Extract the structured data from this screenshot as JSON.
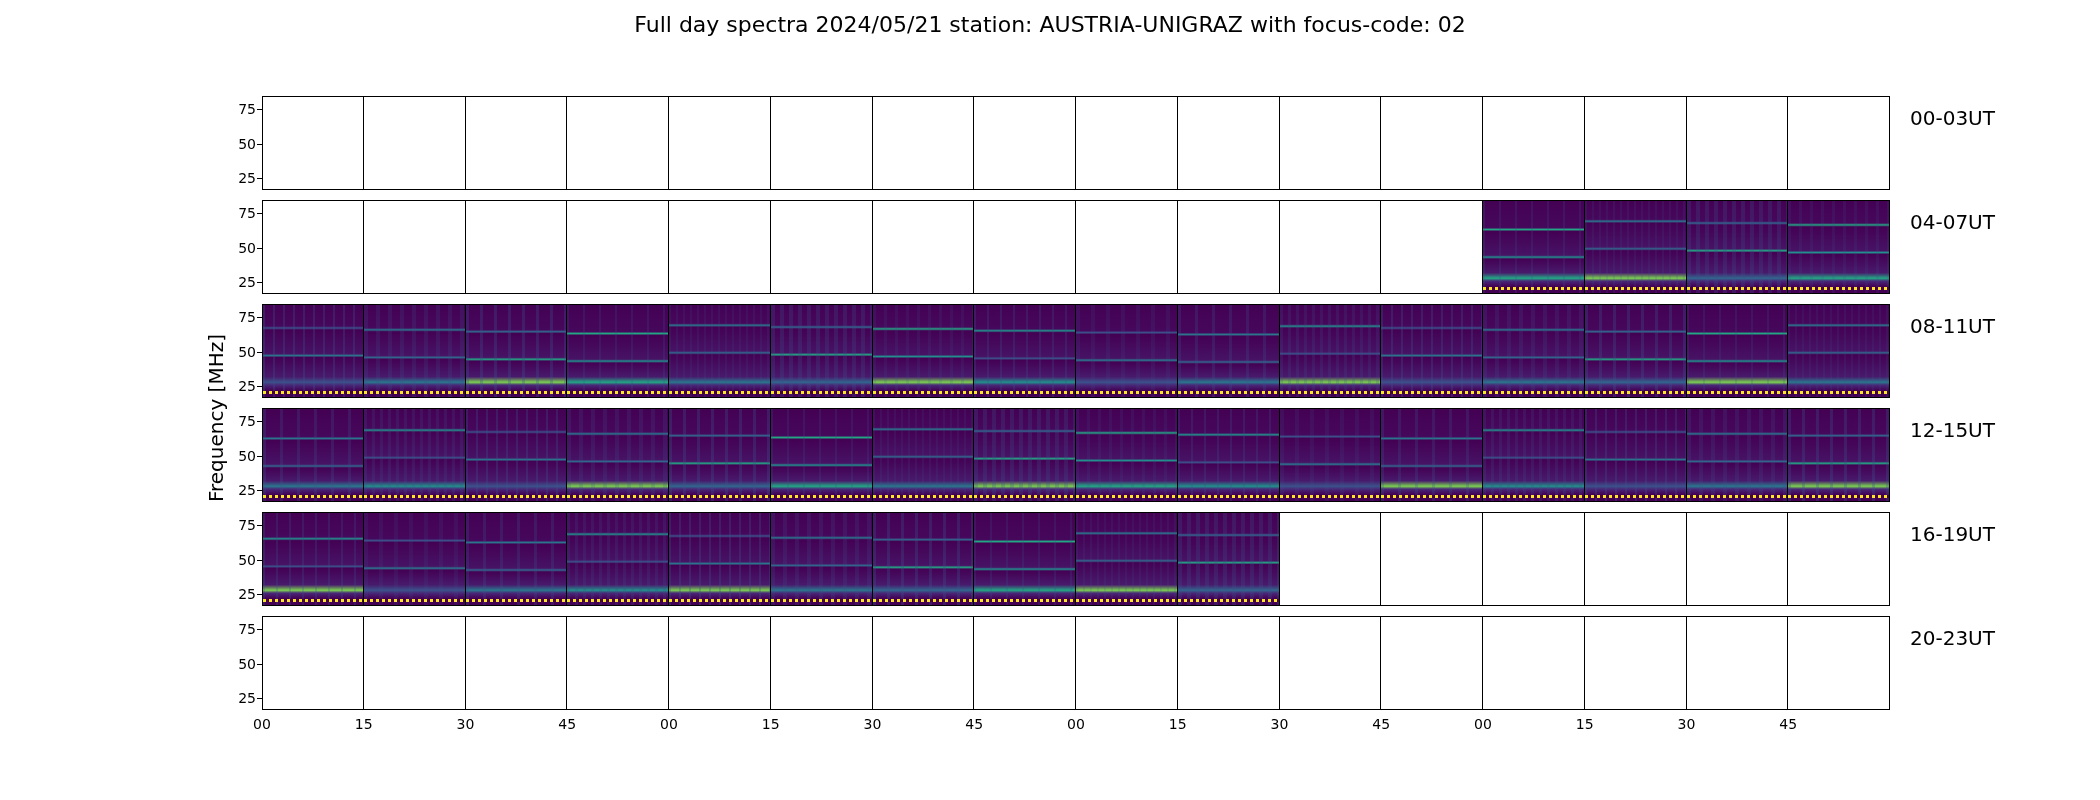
{
  "title": "Full day spectra 2024/05/21 station: AUSTRIA-UNIGRAZ with focus-code: 02",
  "ylabel": "Frequency [MHz]",
  "rows": [
    {
      "label": "00-03UT",
      "yticks": [
        "75",
        "50",
        "25"
      ],
      "panels": [
        {
          "has_data": false
        },
        {
          "has_data": false
        },
        {
          "has_data": false
        },
        {
          "has_data": false
        },
        {
          "has_data": false
        },
        {
          "has_data": false
        },
        {
          "has_data": false
        },
        {
          "has_data": false
        },
        {
          "has_data": false
        },
        {
          "has_data": false
        },
        {
          "has_data": false
        },
        {
          "has_data": false
        },
        {
          "has_data": false
        },
        {
          "has_data": false
        },
        {
          "has_data": false
        },
        {
          "has_data": false
        }
      ]
    },
    {
      "label": "04-07UT",
      "yticks": [
        "75",
        "50",
        "25"
      ],
      "panels": [
        {
          "has_data": false
        },
        {
          "has_data": false
        },
        {
          "has_data": false
        },
        {
          "has_data": false
        },
        {
          "has_data": false
        },
        {
          "has_data": false
        },
        {
          "has_data": false
        },
        {
          "has_data": false
        },
        {
          "has_data": false
        },
        {
          "has_data": false
        },
        {
          "has_data": false
        },
        {
          "has_data": false
        },
        {
          "has_data": true
        },
        {
          "has_data": true
        },
        {
          "has_data": true
        },
        {
          "has_data": true
        }
      ]
    },
    {
      "label": "08-11UT",
      "yticks": [
        "75",
        "50",
        "25"
      ],
      "panels": [
        {
          "has_data": true
        },
        {
          "has_data": true
        },
        {
          "has_data": true
        },
        {
          "has_data": true
        },
        {
          "has_data": true
        },
        {
          "has_data": true
        },
        {
          "has_data": true
        },
        {
          "has_data": true
        },
        {
          "has_data": true
        },
        {
          "has_data": true
        },
        {
          "has_data": true
        },
        {
          "has_data": true
        },
        {
          "has_data": true
        },
        {
          "has_data": true
        },
        {
          "has_data": true
        },
        {
          "has_data": true
        }
      ]
    },
    {
      "label": "12-15UT",
      "yticks": [
        "75",
        "50",
        "25"
      ],
      "panels": [
        {
          "has_data": true
        },
        {
          "has_data": true
        },
        {
          "has_data": true
        },
        {
          "has_data": true
        },
        {
          "has_data": true
        },
        {
          "has_data": true
        },
        {
          "has_data": true
        },
        {
          "has_data": true
        },
        {
          "has_data": true
        },
        {
          "has_data": true
        },
        {
          "has_data": true
        },
        {
          "has_data": true
        },
        {
          "has_data": true
        },
        {
          "has_data": true
        },
        {
          "has_data": true
        },
        {
          "has_data": true
        }
      ]
    },
    {
      "label": "16-19UT",
      "yticks": [
        "75",
        "50",
        "25"
      ],
      "panels": [
        {
          "has_data": true
        },
        {
          "has_data": true
        },
        {
          "has_data": true
        },
        {
          "has_data": true
        },
        {
          "has_data": true
        },
        {
          "has_data": true
        },
        {
          "has_data": true
        },
        {
          "has_data": true
        },
        {
          "has_data": true
        },
        {
          "has_data": true
        },
        {
          "has_data": false
        },
        {
          "has_data": false
        },
        {
          "has_data": false
        },
        {
          "has_data": false
        },
        {
          "has_data": false
        },
        {
          "has_data": false
        }
      ]
    },
    {
      "label": "20-23UT",
      "yticks": [
        "75",
        "50",
        "25"
      ],
      "panels": [
        {
          "has_data": false
        },
        {
          "has_data": false
        },
        {
          "has_data": false
        },
        {
          "has_data": false
        },
        {
          "has_data": false
        },
        {
          "has_data": false
        },
        {
          "has_data": false
        },
        {
          "has_data": false
        },
        {
          "has_data": false
        },
        {
          "has_data": false
        },
        {
          "has_data": false
        },
        {
          "has_data": false
        },
        {
          "has_data": false
        },
        {
          "has_data": false
        },
        {
          "has_data": false
        },
        {
          "has_data": false
        }
      ]
    }
  ],
  "xticks": [
    "00",
    "15",
    "30",
    "45",
    "00",
    "15",
    "30",
    "45",
    "00",
    "15",
    "30",
    "45",
    "00",
    "15",
    "30",
    "45"
  ]
}
